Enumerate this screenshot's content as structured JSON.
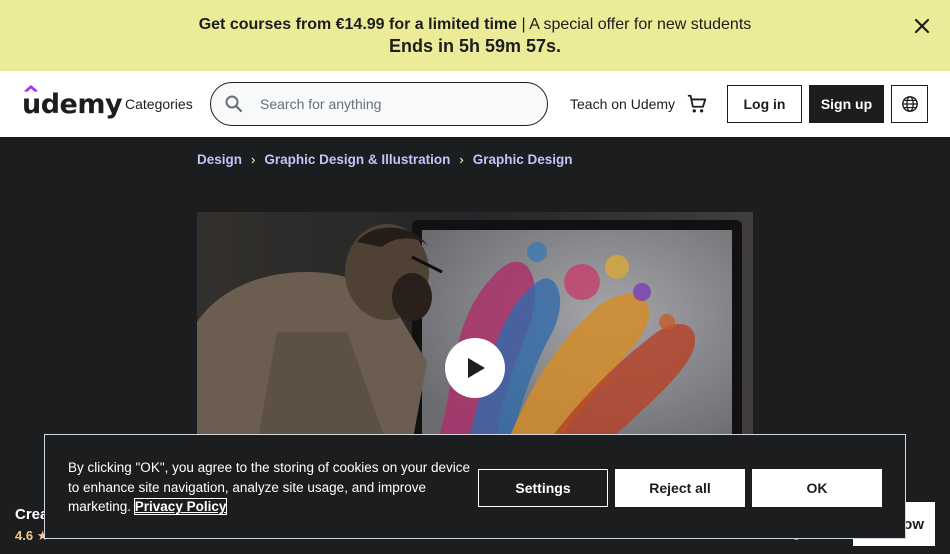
{
  "promo": {
    "bold": "Get courses from €14.99 for a limited time",
    "sep": " | ",
    "rest": "A special offer for new students",
    "countdown": "Ends in 5h 59m 57s.",
    "close_icon": "close-icon"
  },
  "header": {
    "logo": "udemy",
    "categories": "Categories",
    "search_placeholder": "Search for anything",
    "teach": "Teach on Udemy",
    "login": "Log in",
    "signup": "Sign up"
  },
  "breadcrumb": [
    "Design",
    "Graphic Design & Illustration",
    "Graphic Design"
  ],
  "sticky": {
    "title": "Crea",
    "rating": "4.6",
    "price": "€",
    "buy": "ow"
  },
  "cookie": {
    "text": "By clicking \"OK\", you agree to the storing of cookies on your device to enhance site navigation, analyze site usage, and improve marketing. ",
    "link": "Privacy Policy",
    "settings": "Settings",
    "reject": "Reject all",
    "ok": "OK"
  },
  "colors": {
    "promo_bg": "#eceb98",
    "dark": "#1c1d1f",
    "breadcrumb_link": "#c0c4fc",
    "rating": "#f3ca8c",
    "brand": "#a435f0"
  }
}
